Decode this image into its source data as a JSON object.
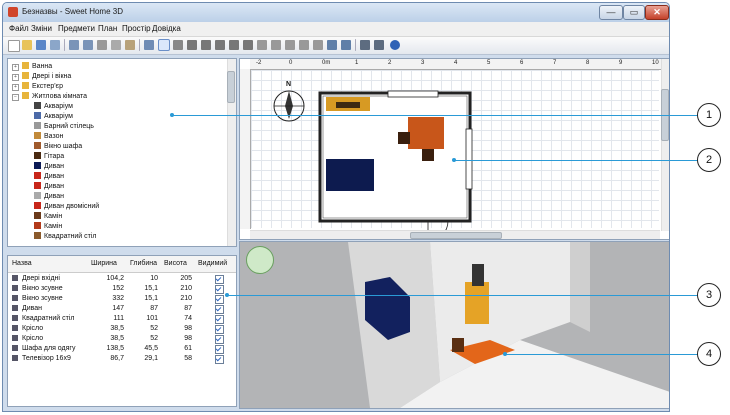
{
  "window": {
    "title": "Безназвы - Sweet Home 3D",
    "min_label": "—",
    "max_label": "▭",
    "close_label": "✕"
  },
  "menu": [
    "Файл",
    "Змiни",
    "Предмети",
    "План",
    "Простір",
    "Довідка"
  ],
  "tree": [
    {
      "label": "Ванна",
      "expand": "+",
      "color": "#e7b43b"
    },
    {
      "label": "Двері і вікна",
      "expand": "+",
      "color": "#e7b43b"
    },
    {
      "label": "Екстер'єр",
      "expand": "+",
      "color": "#e7b43b"
    },
    {
      "label": "Житлова кімната",
      "expand": "−",
      "color": "#e7b43b"
    },
    {
      "label": "Акваріум",
      "color": "#444"
    },
    {
      "label": "Акваріум",
      "color": "#4c6aa8"
    },
    {
      "label": "Барний стілець",
      "color": "#999"
    },
    {
      "label": "Вазон",
      "color": "#c28a3a"
    },
    {
      "label": "Вікно шафа",
      "color": "#a05a2c"
    },
    {
      "label": "Гітара",
      "color": "#4a2a10"
    },
    {
      "label": "Диван",
      "color": "#0c1a55"
    },
    {
      "label": "Диван",
      "color": "#c8261a"
    },
    {
      "label": "Диван",
      "color": "#c8261a"
    },
    {
      "label": "Диван",
      "color": "#aaa"
    },
    {
      "label": "Диван двомісний",
      "color": "#c8261a"
    },
    {
      "label": "Камін",
      "color": "#6b3a1a"
    },
    {
      "label": "Камін",
      "color": "#b33a1a"
    },
    {
      "label": "Квадратний стіл",
      "color": "#8b5a2b"
    }
  ],
  "table": {
    "headers": [
      "Назва",
      "Ширина",
      "Глибина",
      "Висота",
      "Видимий"
    ],
    "rows": [
      {
        "name": "Двері вхідні",
        "w": "104,2",
        "d": "10",
        "h": "205"
      },
      {
        "name": "Вікно зсувне",
        "w": "152",
        "d": "15,1",
        "h": "210"
      },
      {
        "name": "Вікно зсувне",
        "w": "332",
        "d": "15,1",
        "h": "210"
      },
      {
        "name": "Диван",
        "w": "147",
        "d": "87",
        "h": "87"
      },
      {
        "name": "Квадратний стіл",
        "w": "111",
        "d": "101",
        "h": "74"
      },
      {
        "name": "Крісло",
        "w": "38,5",
        "d": "52",
        "h": "98"
      },
      {
        "name": "Крісло",
        "w": "38,5",
        "d": "52",
        "h": "98"
      },
      {
        "name": "Шафа для одягу",
        "w": "138,5",
        "d": "45,5",
        "h": "61"
      },
      {
        "name": "Телевізор 16х9",
        "w": "86,7",
        "d": "29,1",
        "h": "58"
      }
    ]
  },
  "ruler": [
    "-2",
    "0",
    "0m",
    "1",
    "2",
    "3",
    "4",
    "5",
    "6",
    "7",
    "8",
    "9",
    "10"
  ],
  "compass_label": "N",
  "callouts": [
    "1",
    "2",
    "3",
    "4"
  ],
  "colors": {
    "accent": "#2a9ad6",
    "chrome": "#cfdcec"
  }
}
